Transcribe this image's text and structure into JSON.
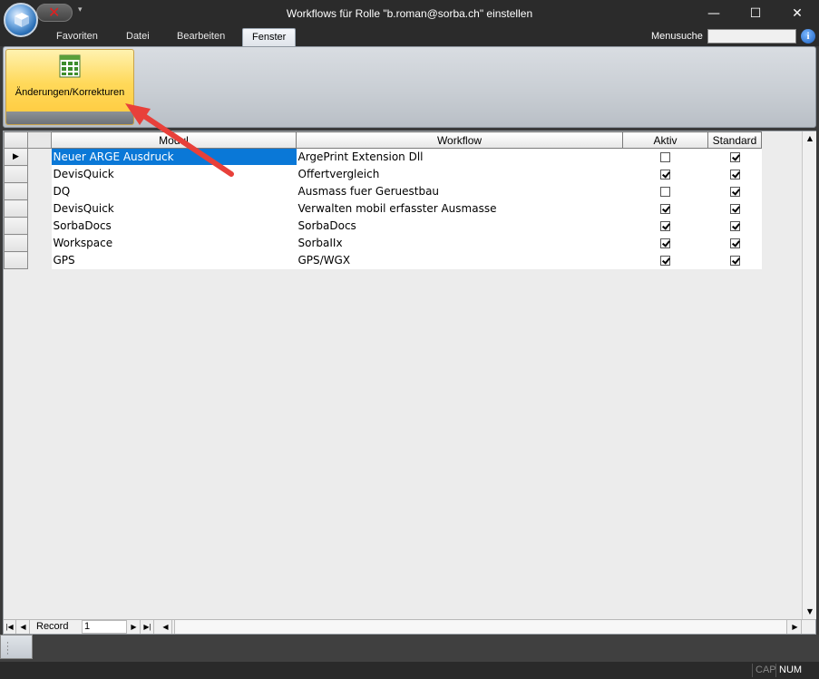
{
  "window": {
    "title": "Workflows für Rolle \"b.roman@sorba.ch\" einstellen",
    "minimize": "—",
    "maximize": "☐",
    "close": "✕"
  },
  "qat": {
    "close_icon": "✕",
    "dropdown_icon": "▾"
  },
  "tabs": [
    {
      "label": "Favoriten"
    },
    {
      "label": "Datei"
    },
    {
      "label": "Bearbeiten"
    },
    {
      "label": "Fenster"
    }
  ],
  "menusuche": {
    "label": "Menusuche",
    "value": "",
    "help_icon": "i"
  },
  "ribbon": {
    "button_label": "Änderungen/Korrekturen"
  },
  "grid": {
    "columns": {
      "modul": "Modul",
      "workflow": "Workflow",
      "aktiv": "Aktiv",
      "standard": "Standard"
    },
    "current_row_marker": "▶",
    "rows": [
      {
        "modul": "Neuer ARGE Ausdruck",
        "workflow": "ArgePrint Extension Dll",
        "aktiv": false,
        "standard": true
      },
      {
        "modul": "DevisQuick",
        "workflow": "Offertvergleich",
        "aktiv": true,
        "standard": true
      },
      {
        "modul": "DQ",
        "workflow": "Ausmass fuer Geruestbau",
        "aktiv": false,
        "standard": true
      },
      {
        "modul": "DevisQuick",
        "workflow": "Verwalten mobil erfasster Ausmasse",
        "aktiv": true,
        "standard": true
      },
      {
        "modul": "SorbaDocs",
        "workflow": "SorbaDocs",
        "aktiv": true,
        "standard": true
      },
      {
        "modul": "Workspace",
        "workflow": "SorbaIIx",
        "aktiv": true,
        "standard": true
      },
      {
        "modul": "GPS",
        "workflow": "GPS/WGX",
        "aktiv": true,
        "standard": true
      }
    ]
  },
  "navigator": {
    "first": "|◀",
    "prev": "◀",
    "label": "Record",
    "value": "1",
    "next": "▶",
    "last": "▶|",
    "new": "▶*",
    "scroll_left": "◀",
    "scroll_right": "▶"
  },
  "scroll": {
    "up": "▲",
    "down": "▼"
  },
  "status": {
    "cap": "CAP",
    "num": "NUM"
  },
  "colors": {
    "selection": "#0a78d7",
    "ribbon_active": "#ffd95a",
    "arrow": "#e8403a"
  }
}
